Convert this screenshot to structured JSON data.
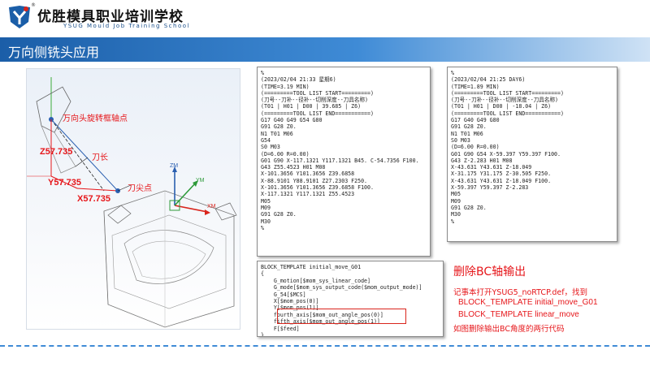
{
  "header": {
    "school_name": "优胜模具职业培训学校",
    "school_name_en": "YSUG Mould Job Training School",
    "registered_mark": "®",
    "brand_color": "#1b5ea8"
  },
  "title": "万向侧铣头应用",
  "cad_labels": {
    "rotation_axis": "万向头旋转框轴点",
    "tool_length": "刀长",
    "tool_tip": "刀尖点",
    "z_value": "Z57.735",
    "y_value": "Y57.735",
    "x_value": "X57.735",
    "zm": "ZM",
    "ym": "YM",
    "xm": "XM"
  },
  "code_panel_1": [
    "%",
    "(2023/02/04 21:33 星期6)",
    "(TIME=3.19 MIN)",
    "(=========TOOL LIST START=========)",
    "(刀号--刀补--径补--切削深度--刀具名称)",
    "(T01 | H01 | D00 | 39.685 | Z6)",
    "(=========TOOL LIST END===========)",
    "G17 G40 G49 G54 G80",
    "G91 G28 Z0.",
    "N1 T01 M06",
    "G54",
    "S0 M03",
    "(D=6.00 R=0.00)",
    "G01 G90 X-117.1321 Y117.1321 B45. C-54.7356 F100.",
    "G43 Z55.4523 H01 M08",
    "X-101.3656 Y101.3656 Z39.6858",
    "X-88.9101 Y88.9101 Z27.2303 F250.",
    "X-101.3656 Y101.3656 Z39.6858 F100.",
    "X-117.1321 Y117.1321 Z55.4523",
    "M05",
    "M09",
    "G91 G28 Z0.",
    "M30",
    "%"
  ],
  "code_panel_2": [
    "%",
    "(2023/02/04 21:25 DAY6)",
    "(TIME=1.89 MIN)",
    "(=========TOOL LIST START=========)",
    "(刀号--刀补--径补--切削深度--刀具名称)",
    "(T01 | H01 | D00 | -18.04 | Z6)",
    "(=========TOOL LIST END===========)",
    "G17 G40 G49 G80",
    "G91 G28 Z0.",
    "N1 T01 M06",
    "S0 M03",
    "(D=6.00 R=0.00)",
    "G01 G90 G54 X-59.397 Y59.397 F100.",
    "G43 Z-2.283 H01 M08",
    "X-43.631 Y43.631 Z-18.049",
    "X-31.175 Y31.175 Z-30.505 F250.",
    "X-43.631 Y43.631 Z-18.049 F100.",
    "X-59.397 Y59.397 Z-2.283",
    "M05",
    "M09",
    "G91 G28 Z0.",
    "M30",
    "%"
  ],
  "code_panel_3": [
    "BLOCK_TEMPLATE initial_move_G01",
    "{",
    "    G_motion[$mom_sys_linear_code]",
    "    G_mode[$mom_sys_output_code($mom_output_mode)]",
    "    G_54[$MCS]",
    "    X[$mom_pos(0)]",
    "    Y[$mom_pos(1)]",
    "    fourth_axis[$mom_out_angle_pos(0)]",
    "    fifth_axis[$mom_out_angle_pos(1)]",
    "    F[$feed]",
    "}"
  ],
  "notes": {
    "title": "删除BC轴输出",
    "line1": "记事本打开YSUG5_noRTCP.def，找到",
    "line2": "BLOCK_TEMPLATE initial_move_G01",
    "line3": "BLOCK_TEMPLATE linear_move",
    "line4": "如图删除输出BC角度的两行代码",
    "color": "#e6161a"
  }
}
